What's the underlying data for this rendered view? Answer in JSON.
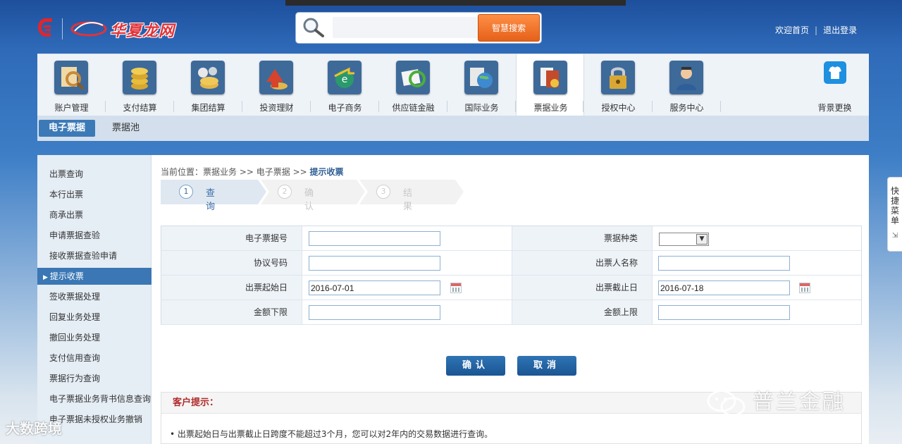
{
  "brand": {
    "name": "华夏龙网"
  },
  "search": {
    "placeholder": "",
    "button": "智慧搜索"
  },
  "toplinks": {
    "home": "欢迎首页",
    "logout": "退出登录",
    "separator": "|"
  },
  "nav": {
    "items": [
      {
        "label": "账户管理",
        "icon": "account-magnifier-icon",
        "color": "#b97a3a"
      },
      {
        "label": "支付结算",
        "icon": "coins-icon",
        "color": "#c8a030"
      },
      {
        "label": "集团结算",
        "icon": "group-coins-icon",
        "color": "#7d96a8"
      },
      {
        "label": "投资理财",
        "icon": "investment-arrow-icon",
        "color": "#c94a2e"
      },
      {
        "label": "电子商务",
        "icon": "ecommerce-globe-icon",
        "color": "#2e8d64"
      },
      {
        "label": "供应链金融",
        "icon": "supply-chain-icon",
        "color": "#4a9a3c"
      },
      {
        "label": "国际业务",
        "icon": "globe-icon",
        "color": "#3a7fb8"
      },
      {
        "label": "票据业务",
        "icon": "bill-document-icon",
        "color": "#b9462c"
      },
      {
        "label": "授权中心",
        "icon": "lock-icon",
        "color": "#c49a2c"
      },
      {
        "label": "服务中心",
        "icon": "customer-service-icon",
        "color": "#3b6fa8"
      }
    ],
    "active_index": 7,
    "skin": {
      "label": "背景更换",
      "icon": "tshirt-icon"
    }
  },
  "subnav": {
    "tabs": [
      "电子票据",
      "票据池"
    ],
    "active_index": 0
  },
  "sidebar": {
    "items": [
      "出票查询",
      "本行出票",
      "商承出票",
      "申请票据查验",
      "接收票据查验申请",
      "提示收票",
      "签收票据处理",
      "回复业务处理",
      "撤回业务处理",
      "支付信用查询",
      "票据行为查询",
      "电子票据业务背书信息查询",
      "电子票据未授权业务撤销"
    ],
    "active_index": 5
  },
  "breadcrumb": {
    "prefix": "当前位置：",
    "path": "票据业务 >> 电子票据 >> ",
    "current": "提示收票"
  },
  "steps": [
    {
      "num": "1",
      "label": "查询"
    },
    {
      "num": "2",
      "label": "确认"
    },
    {
      "num": "3",
      "label": "结果"
    }
  ],
  "form": {
    "bill_no_label": "电子票据号",
    "bill_type_label": "票据种类",
    "agreement_no_label": "协议号码",
    "drawer_name_label": "出票人名称",
    "issue_start_label": "出票起始日",
    "issue_start_value": "2016-07-01",
    "issue_end_label": "出票截止日",
    "issue_end_value": "2016-07-18",
    "amount_min_label": "金额下限",
    "amount_max_label": "金额上限"
  },
  "buttons": {
    "confirm": "确认",
    "cancel": "取消"
  },
  "notice": {
    "title": "客户提示：",
    "line": "• 出票起始日与出票截止日跨度不能超过3个月，您可以对2年内的交易数据进行查询。"
  },
  "quickmenu": {
    "chars": [
      "快",
      "捷",
      "菜",
      "单"
    ],
    "icon": "⇲"
  },
  "watermark": {
    "right": "普兰金融",
    "left": "大数跨境"
  }
}
